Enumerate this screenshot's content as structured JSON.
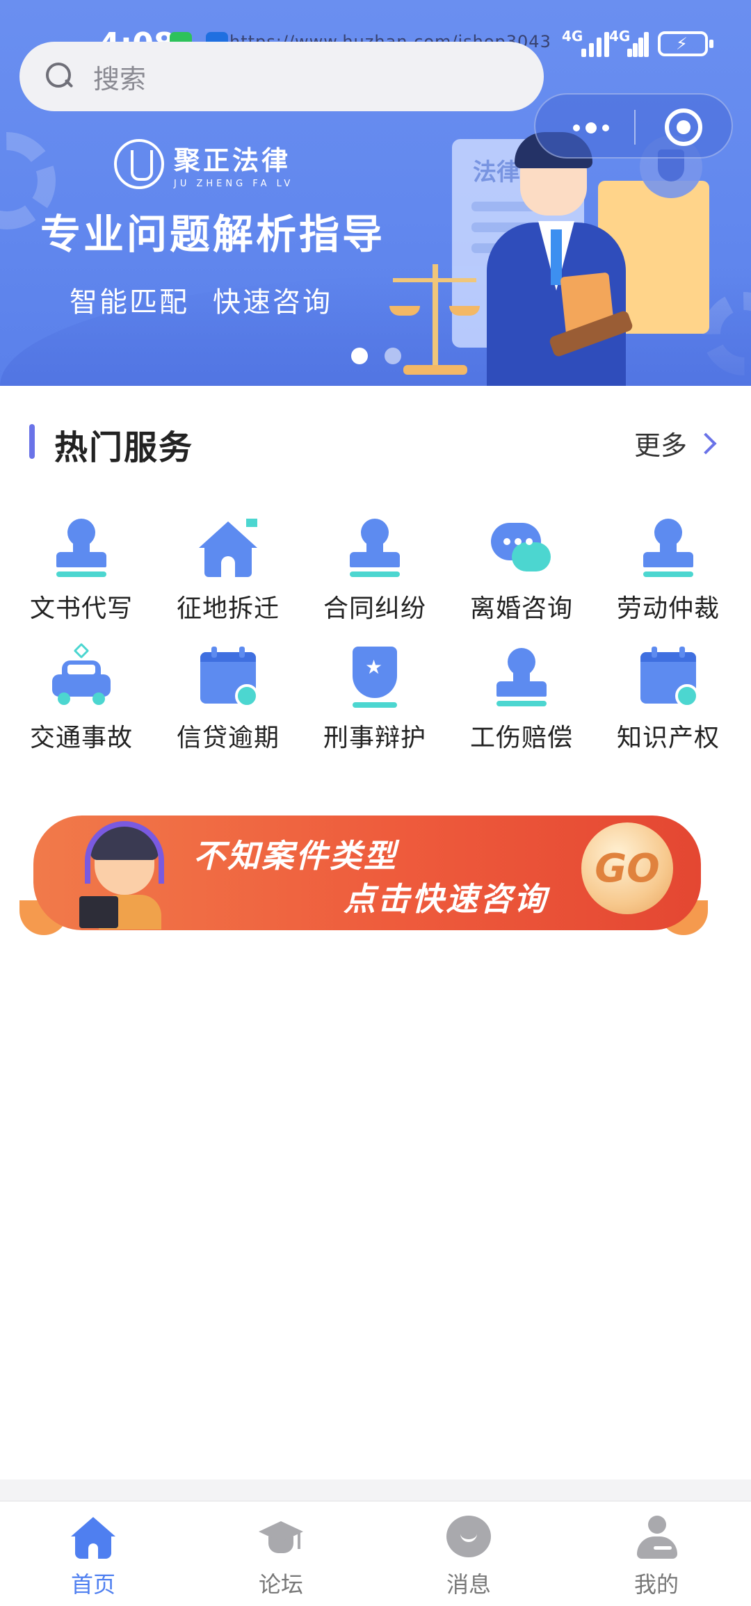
{
  "status_bar": {
    "time": "4:08",
    "url_watermark": "https://www.huzhan.com/ishop3043",
    "network_1": "4G",
    "network_2": "4G"
  },
  "search": {
    "placeholder": "搜索"
  },
  "banner": {
    "logo_cn": "聚正法律",
    "logo_en": "JU ZHENG FA LV",
    "title": "专业问题解析指导",
    "subtitle_1": "智能匹配",
    "subtitle_2": "快速咨询",
    "doc_label": "法律",
    "active_slide": 1,
    "slide_count": 2
  },
  "hot_services": {
    "title": "热门服务",
    "more_label": "更多",
    "items": [
      {
        "label": "文书代写",
        "icon": "stamp-icon"
      },
      {
        "label": "征地拆迁",
        "icon": "house-icon"
      },
      {
        "label": "合同纠纷",
        "icon": "stamp-icon"
      },
      {
        "label": "离婚咨询",
        "icon": "chat-icon"
      },
      {
        "label": "劳动仲裁",
        "icon": "stamp-icon"
      },
      {
        "label": "交通事故",
        "icon": "car-icon"
      },
      {
        "label": "信贷逾期",
        "icon": "calendar-icon"
      },
      {
        "label": "刑事辩护",
        "icon": "shield-icon"
      },
      {
        "label": "工伤赔偿",
        "icon": "stamp-icon"
      },
      {
        "label": "知识产权",
        "icon": "calendar-icon"
      }
    ]
  },
  "promo": {
    "line_1": "不知案件类型",
    "line_2": "点击快速咨询",
    "go_label": "GO"
  },
  "tab_bar": {
    "items": [
      {
        "label": "首页",
        "icon": "home-icon",
        "active": true
      },
      {
        "label": "论坛",
        "icon": "graduation-cap-icon",
        "active": false
      },
      {
        "label": "消息",
        "icon": "message-icon",
        "active": false
      },
      {
        "label": "我的",
        "icon": "profile-icon",
        "active": false
      }
    ]
  },
  "colors": {
    "brand_blue": "#5d8bf0",
    "accent_purple": "#6a73e8",
    "accent_teal": "#4cd6d0",
    "promo_red": "#ee5b3c",
    "tab_active": "#4f7ff0",
    "tab_inactive": "#a9a9ad"
  }
}
